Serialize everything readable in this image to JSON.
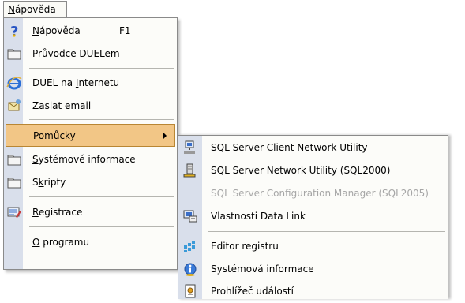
{
  "menubar": {
    "title_pre": "",
    "title_acc": "N",
    "title_post": "ápověda"
  },
  "main_menu": {
    "items": [
      {
        "pre": "",
        "acc": "N",
        "post": "ápověda",
        "shortcut": "F1",
        "icon": "help-question-icon"
      },
      {
        "pre": "",
        "acc": "P",
        "post": "růvodce DUELem",
        "icon": "folder-icon"
      },
      {
        "pre": "DUEL na ",
        "acc": "I",
        "post": "nternetu",
        "icon": "internet-explorer-icon"
      },
      {
        "pre": "Zaslat ",
        "acc": "e",
        "post": "mail",
        "icon": "email-icon"
      },
      {
        "pre": "Pomůcky",
        "acc": "",
        "post": "",
        "icon": "none",
        "highlighted": true,
        "has_submenu": true
      },
      {
        "pre": "",
        "acc": "S",
        "post": "ystémové informace",
        "icon": "folder-icon"
      },
      {
        "pre": "S",
        "acc": "k",
        "post": "ripty",
        "icon": "folder-icon"
      },
      {
        "pre": "",
        "acc": "R",
        "post": "egistrace",
        "icon": "registration-icon"
      },
      {
        "pre": "",
        "acc": "O",
        "post": " programu",
        "icon": "none"
      }
    ]
  },
  "sub_menu": {
    "items": [
      {
        "label": "SQL Server Client Network Utility",
        "icon": "network-computer-icon"
      },
      {
        "label": "SQL Server Network Utility (SQL2000)",
        "icon": "network-computer-icon"
      },
      {
        "label": "SQL Server Configuration Manager (SQL2005)",
        "icon": "none",
        "disabled": true
      },
      {
        "label": "Vlastnosti Data Link",
        "icon": "data-link-icon"
      },
      {
        "label": "Editor registru",
        "icon": "registry-editor-icon"
      },
      {
        "label": "Systémová informace",
        "icon": "system-info-icon"
      },
      {
        "label": "Prohlížeč událostí",
        "icon": "event-viewer-icon"
      }
    ]
  },
  "colors": {
    "highlight": "#f2c686",
    "highlight_border": "#b98633",
    "icon_strip": "#d9dfeb",
    "menu_bg": "#fcfcf9",
    "disabled_text": "#a6a6a6"
  }
}
